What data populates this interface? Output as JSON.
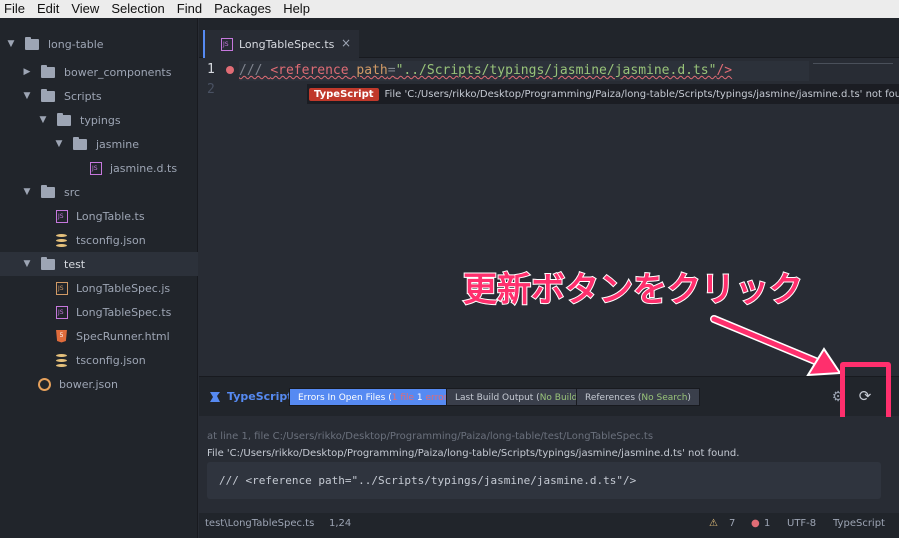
{
  "menu": [
    "File",
    "Edit",
    "View",
    "Selection",
    "Find",
    "Packages",
    "Help"
  ],
  "tree": {
    "root": "long-table",
    "items": [
      {
        "label": "bower_components"
      },
      {
        "label": "Scripts"
      },
      {
        "label": "typings"
      },
      {
        "label": "jasmine"
      },
      {
        "label": "jasmine.d.ts"
      },
      {
        "label": "src"
      },
      {
        "label": "LongTable.ts"
      },
      {
        "label": "tsconfig.json"
      },
      {
        "label": "test"
      },
      {
        "label": "LongTableSpec.js"
      },
      {
        "label": "LongTableSpec.ts"
      },
      {
        "label": "SpecRunner.html"
      },
      {
        "label": "tsconfig.json"
      },
      {
        "label": "bower.json"
      }
    ]
  },
  "tab": {
    "label": "LongTableSpec.ts",
    "close": "×"
  },
  "editor": {
    "line1": "1",
    "line2": "2",
    "code": {
      "c1": "/// ",
      "c2": "<reference",
      "c3": " path",
      "c4": "=",
      "c5": "\"../Scripts/typings/jasmine/jasmine.d.ts\"",
      "c6": "/>"
    },
    "tooltip_badge": "TypeScript",
    "tooltip_text": "File 'C:/Users/rikko/Desktop/Programming/Paiza/long-table/Scripts/typings/jasmine/jasmine.d.ts' not found."
  },
  "annotation": {
    "text": "更新ボタンをクリック",
    "color": "#ff2f6d"
  },
  "panel": {
    "title": "TypeScript",
    "errors_btn": {
      "label": "Errors In Open Files (",
      "n1": "1",
      "mid": " file ",
      "n2": "1",
      "tail": " error",
      "close": ")"
    },
    "build_btn": {
      "label": "Last Build Output (",
      "status": "No Build",
      "close": ")"
    },
    "refs_btn": {
      "label": "References (",
      "status": "No Search",
      "close": ")"
    },
    "msg_location": "at line 1, file C:/Users/rikko/Desktop/Programming/Paiza/long-table/test/LongTableSpec.ts",
    "msg_text": "File 'C:/Users/rikko/Desktop/Programming/Paiza/long-table/Scripts/typings/jasmine/jasmine.d.ts' not found.",
    "code": "/// <reference path=\"../Scripts/typings/jasmine/jasmine.d.ts\"/>"
  },
  "status": {
    "file": "test\\LongTableSpec.ts",
    "position": "1,24",
    "warnings": "7",
    "errors": "1",
    "encoding": "UTF-8",
    "grammar": "TypeScript"
  },
  "colors": {
    "accent": "#568af2",
    "error": "#e06c75",
    "highlight": "#ff2f6d"
  }
}
